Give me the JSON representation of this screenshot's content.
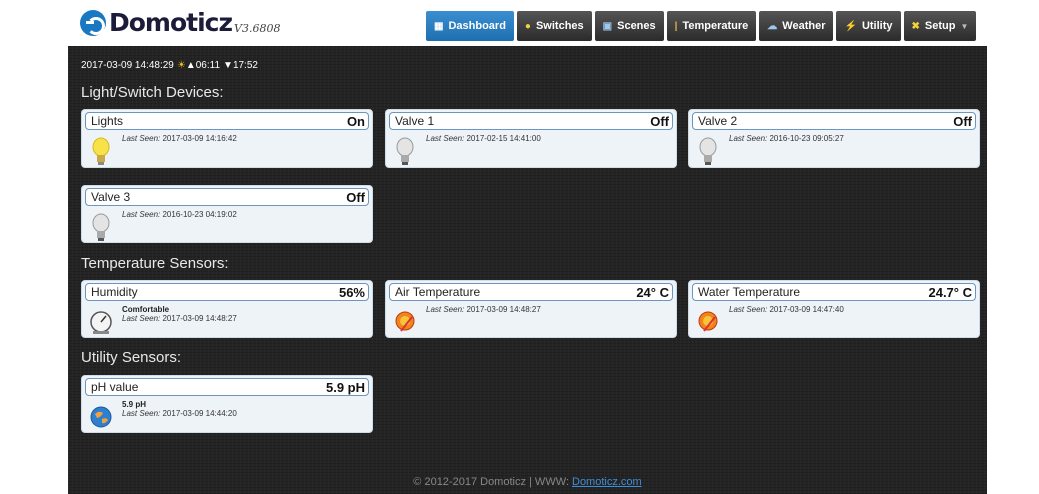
{
  "app": {
    "name": "Domoticz",
    "version": "V3.6808"
  },
  "nav": [
    {
      "label": "Dashboard",
      "icon": "dashboard-icon",
      "glyph": "▦",
      "active": true
    },
    {
      "label": "Switches",
      "icon": "bulb-icon",
      "glyph": "💡",
      "active": false
    },
    {
      "label": "Scenes",
      "icon": "scenes-icon",
      "glyph": "▣",
      "active": false
    },
    {
      "label": "Temperature",
      "icon": "thermometer-icon",
      "glyph": "🌡",
      "active": false
    },
    {
      "label": "Weather",
      "icon": "weather-icon",
      "glyph": "☁",
      "active": false
    },
    {
      "label": "Utility",
      "icon": "utility-icon",
      "glyph": "⚡",
      "active": false
    },
    {
      "label": "Setup",
      "icon": "tools-icon",
      "glyph": "✖",
      "active": false,
      "dropdown": true
    }
  ],
  "timebar": {
    "datetime": "2017-03-09 14:48:29",
    "sunrise": "06:11",
    "sunset": "17:52"
  },
  "sections": {
    "switches": "Light/Switch Devices:",
    "temperature": "Temperature Sensors:",
    "utility": "Utility Sensors:"
  },
  "last_seen_label": "Last Seen:",
  "devices": {
    "lights": {
      "name": "Lights",
      "status": "On",
      "last_seen": "2017-03-09 14:16:42",
      "icon": "bulb-on-icon"
    },
    "valve1": {
      "name": "Valve 1",
      "status": "Off",
      "last_seen": "2017-02-15 14:41:00",
      "icon": "bulb-off-icon"
    },
    "valve2": {
      "name": "Valve 2",
      "status": "Off",
      "last_seen": "2016-10-23 09:05:27",
      "icon": "bulb-off-icon"
    },
    "valve3": {
      "name": "Valve 3",
      "status": "Off",
      "last_seen": "2016-10-23 04:19:02",
      "icon": "bulb-off-icon"
    },
    "humidity": {
      "name": "Humidity",
      "status": "56%",
      "line1": "Comfortable",
      "last_seen": "2017-03-09 14:48:27",
      "icon": "gauge-icon"
    },
    "air_temp": {
      "name": "Air Temperature",
      "status": "24° C",
      "last_seen": "2017-03-09 14:48:27",
      "icon": "temperature-icon"
    },
    "water_temp": {
      "name": "Water Temperature",
      "status": "24.7° C",
      "last_seen": "2017-03-09 14:47:40",
      "icon": "temperature-icon"
    },
    "ph": {
      "name": "pH value",
      "status": "5.9 pH",
      "line1": "5.9 pH",
      "last_seen": "2017-03-09 14:44:20",
      "icon": "globe-icon"
    }
  },
  "footer": {
    "text": "© 2012-2017 Domoticz | WWW:",
    "link": "Domoticz.com"
  },
  "colors": {
    "accent": "#2a82c8",
    "background": "#242424",
    "card": "#eef3f8"
  }
}
